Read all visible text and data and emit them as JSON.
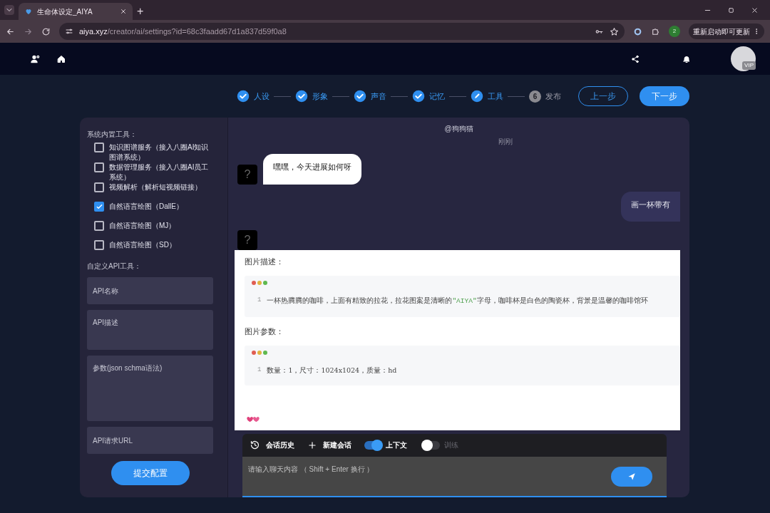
{
  "browser": {
    "tab_title": "生命体设定_AIYA",
    "new_tab": "+",
    "url_host": "aiya.xyz",
    "url_path": "/creator/ai/settings?id=68c3faadd67d1a837d59f0a8",
    "profile_badge": "2",
    "update_button": "重新启动即可更新"
  },
  "header": {
    "avatar_badge": "VIP"
  },
  "steps": [
    {
      "label": "人设",
      "kind": "done"
    },
    {
      "label": "形象",
      "kind": "done"
    },
    {
      "label": "声音",
      "kind": "done"
    },
    {
      "label": "记忆",
      "kind": "done"
    },
    {
      "label": "工具",
      "kind": "current"
    },
    {
      "label": "发布",
      "kind": "pending",
      "number": "6"
    }
  ],
  "nav_buttons": {
    "prev": "上一步",
    "next": "下一步"
  },
  "tools": {
    "builtin_title": "系统内置工具：",
    "items": [
      {
        "label": "知识图谱服务（接入八圈AI知识图谱系统）",
        "checked": false
      },
      {
        "label": "数据管理服务（接入八圈AI员工系统）",
        "checked": false
      },
      {
        "label": "视频解析（解析短视频链接）",
        "checked": false
      },
      {
        "label": "自然语言绘图（DallE）",
        "checked": true
      },
      {
        "label": "自然语言绘图（MJ）",
        "checked": false
      },
      {
        "label": "自然语言绘图（SD）",
        "checked": false
      }
    ],
    "custom_title": "自定义API工具：",
    "fields": [
      {
        "placeholder": "API名称",
        "kind": "input"
      },
      {
        "placeholder": "API描述",
        "kind": "textarea"
      },
      {
        "placeholder": "参数(json schma语法)",
        "kind": "tall"
      },
      {
        "placeholder": "API请求URL",
        "kind": "input"
      }
    ],
    "submit": "提交配置"
  },
  "chat": {
    "title": "@狗狗猫",
    "time": "刚刚",
    "messages": [
      {
        "kind": "bot",
        "avatar": "?",
        "text": "嘿嘿，今天进展如何呀"
      },
      {
        "kind": "user",
        "text": "画一杯带有"
      },
      {
        "kind": "card",
        "avatar": "?",
        "sections": [
          {
            "heading": "图片描述：",
            "lines": [
              {
                "number": "1",
                "tokens": [
                  {
                    "kind": "plain",
                    "text": "一杯热腾腾的咖啡，上面有精致的拉花，拉花图案是清晰的"
                  },
                  {
                    "kind": "string",
                    "text": "\"AIYA\""
                  },
                  {
                    "kind": "plain",
                    "text": "字母，咖啡杯是白色的陶瓷杯，背景是温馨的咖啡馆环"
                  }
                ]
              }
            ]
          },
          {
            "heading": "图片参数：",
            "lines": [
              {
                "number": "1",
                "tokens": [
                  {
                    "kind": "plain",
                    "text": "数量：1，尺寸：1024x1024，质量：hd"
                  }
                ]
              }
            ]
          }
        ]
      }
    ]
  },
  "composer": {
    "history": "会话历史",
    "new_chat": "新建会话",
    "toggles": [
      {
        "label": "上下文",
        "on": true
      },
      {
        "label": "训练",
        "on": false
      }
    ],
    "placeholder": "请输入聊天内容 （ Shift + Enter 换行 ）"
  }
}
